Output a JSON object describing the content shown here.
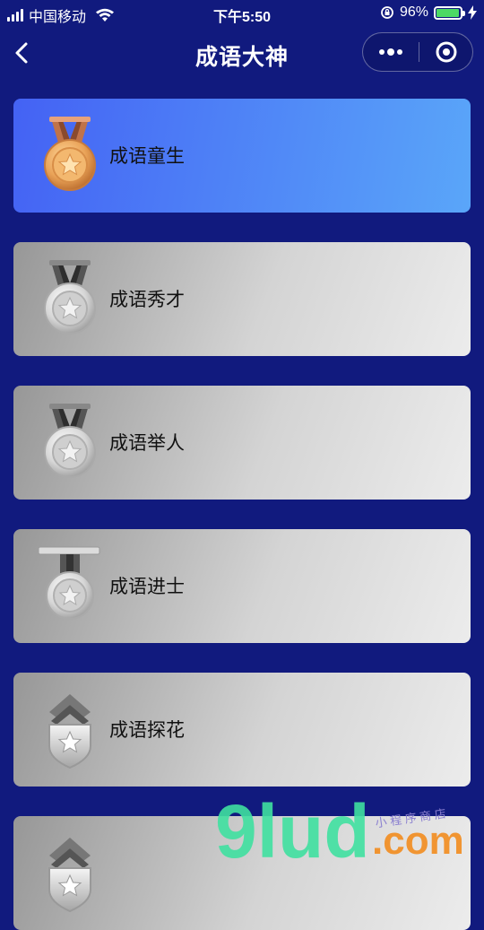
{
  "status_bar": {
    "carrier": "中国移动",
    "time": "下午5:50",
    "battery_percent": "96%",
    "battery_level": 0.96
  },
  "nav": {
    "title": "成语大神"
  },
  "levels": [
    {
      "label": "成语童生",
      "medal": "bronze-medal-icon",
      "unlocked": true
    },
    {
      "label": "成语秀才",
      "medal": "silver-medal-icon",
      "unlocked": false
    },
    {
      "label": "成语举人",
      "medal": "silver-medal-icon",
      "unlocked": false
    },
    {
      "label": "成语进士",
      "medal": "bar-medal-icon",
      "unlocked": false
    },
    {
      "label": "成语探花",
      "medal": "chevron-badge-icon",
      "unlocked": false
    },
    {
      "label": "",
      "medal": "chevron-badge-icon",
      "unlocked": false
    }
  ],
  "watermark": {
    "main": "9lud",
    "suffix": ".com",
    "tagline": "小 程 序 商 店"
  },
  "colors": {
    "background": "#111a7e",
    "active_card_start": "#4462f4",
    "active_card_end": "#5aa6f9",
    "inactive_card": "#c8c8c8",
    "watermark_green": "#3fe0a0",
    "watermark_orange": "#f28c1e"
  }
}
